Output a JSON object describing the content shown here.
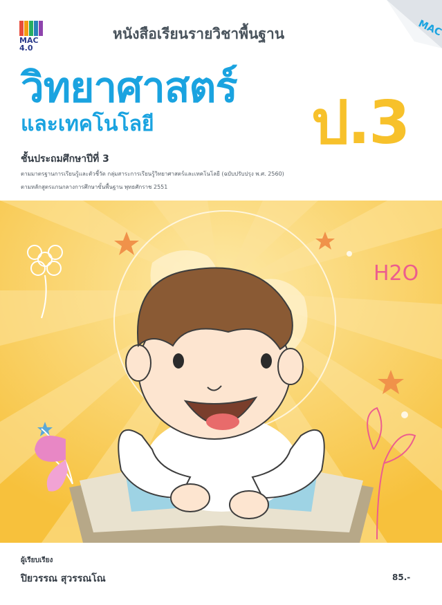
{
  "cover": {
    "publisher_logo": "MAC 4.0",
    "corner_logo": "MAC",
    "series": "หนังสือเรียนรายวิชาพื้นฐาน",
    "title_main": "วิทยาศาสตร์",
    "title_sub": "และเทคโนโลยี",
    "grade": "ป.3",
    "level": "ชั้นประถมศึกษาปีที่ 3",
    "standard_line1": "ตามมาตรฐานการเรียนรู้และตัวชี้วัด กลุ่มสาระการเรียนรู้วิทยาศาสตร์และเทคโนโลยี (ฉบับปรับปรุง พ.ศ. 2560)",
    "standard_line2": "ตามหลักสูตรแกนกลางการศึกษาขั้นพื้นฐาน พุทธศักราช 2551",
    "author_label": "ผู้เรียบเรียง",
    "author_name": "ปิยวรรณ สุวรรณโณ",
    "price": "85.-",
    "illustration_text": "H2O"
  },
  "colors": {
    "title_blue": "#1aa3e0",
    "grade_yellow": "#f7c12b",
    "background_yellow": "#f9c94a",
    "text_dark": "#333b44"
  }
}
